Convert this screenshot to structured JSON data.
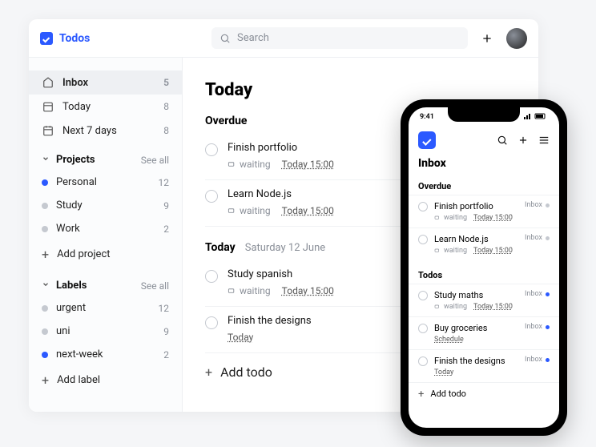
{
  "app": {
    "name": "Todos"
  },
  "topbar": {
    "search_placeholder": "Search",
    "plus": "+"
  },
  "sidebar": {
    "smart_lists": [
      {
        "label": "Inbox",
        "count": "5",
        "icon": "home"
      },
      {
        "label": "Today",
        "count": "8",
        "icon": "calendar-day"
      },
      {
        "label": "Next 7 days",
        "count": "8",
        "icon": "calendar-week"
      }
    ],
    "projects_header": "Projects",
    "see_all": "See all",
    "projects": [
      {
        "label": "Personal",
        "count": "12",
        "color": "#2b59ff"
      },
      {
        "label": "Study",
        "count": "9",
        "color": "#c5c9d0"
      },
      {
        "label": "Work",
        "count": "2",
        "color": "#c5c9d0"
      }
    ],
    "add_project": "Add project",
    "labels_header": "Labels",
    "labels": [
      {
        "label": "urgent",
        "count": "12",
        "color": "#c5c9d0"
      },
      {
        "label": "uni",
        "count": "9",
        "color": "#c5c9d0"
      },
      {
        "label": "next-week",
        "count": "2",
        "color": "#2b59ff"
      }
    ],
    "add_label": "Add label"
  },
  "main": {
    "title": "Today",
    "groups": [
      {
        "heading": "Overdue",
        "subheading": "",
        "tasks": [
          {
            "title": "Finish portfolio",
            "tag": "waiting",
            "due": "Today 15:00"
          },
          {
            "title": "Learn Node.js",
            "tag": "waiting",
            "due": "Today 15:00"
          }
        ]
      },
      {
        "heading": "Today",
        "subheading": "Saturday 12 June",
        "tasks": [
          {
            "title": "Study spanish",
            "tag": "waiting",
            "due": "Today 15:00"
          },
          {
            "title": "Finish the designs",
            "tag": "",
            "due": "Today"
          }
        ]
      }
    ],
    "add_todo": "Add todo"
  },
  "phone": {
    "time": "9:41",
    "title": "Inbox",
    "sections": [
      {
        "heading": "Overdue",
        "tasks": [
          {
            "title": "Finish portfolio",
            "tag": "waiting",
            "due": "Today 15:00",
            "list": "Inbox",
            "dot": "grey"
          },
          {
            "title": "Learn Node.js",
            "tag": "waiting",
            "due": "Today 15:00",
            "list": "Inbox",
            "dot": "grey"
          }
        ]
      },
      {
        "heading": "Todos",
        "tasks": [
          {
            "title": "Study maths",
            "tag": "waiting",
            "due": "Today 15:00",
            "list": "Inbox",
            "dot": "blue"
          },
          {
            "title": "Buy groceries",
            "tag": "",
            "due": "Schedule",
            "list": "Inbox",
            "dot": "blue"
          },
          {
            "title": "Finish the designs",
            "tag": "",
            "due": "Today",
            "list": "Inbox",
            "dot": "blue"
          }
        ]
      }
    ],
    "add_todo": "Add todo"
  },
  "colors": {
    "accent": "#2b59ff"
  }
}
